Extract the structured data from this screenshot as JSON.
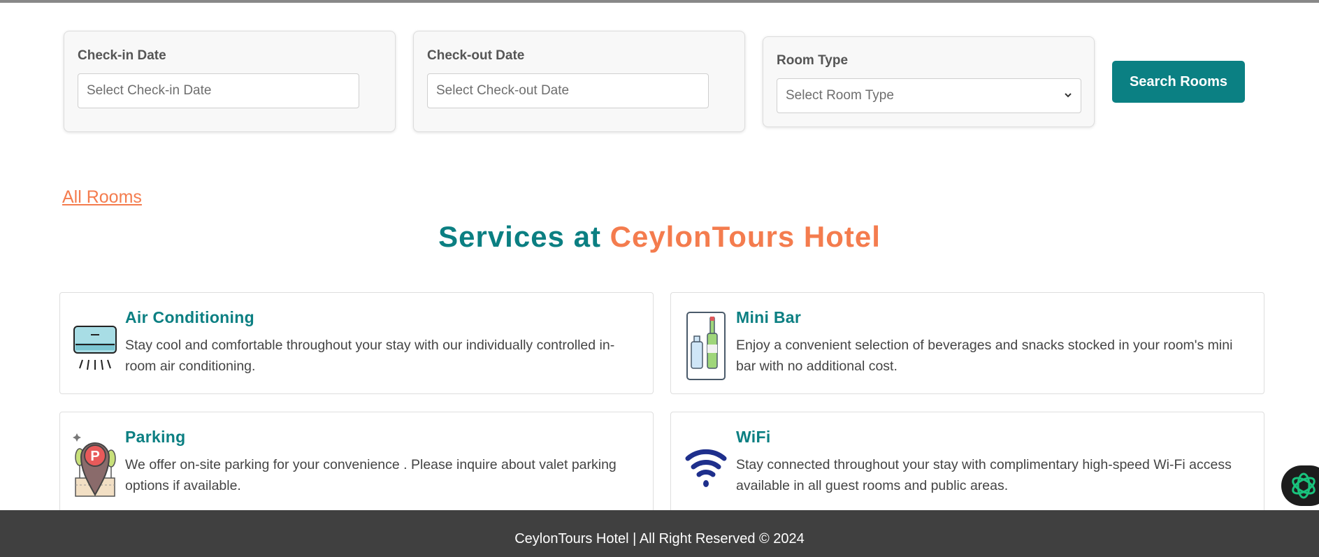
{
  "search": {
    "checkin_label": "Check-in Date",
    "checkin_placeholder": "Select Check-in Date",
    "checkout_label": "Check-out Date",
    "checkout_placeholder": "Select Check-out Date",
    "roomtype_label": "Room Type",
    "roomtype_selected": "Select Room Type",
    "button_label": "Search Rooms"
  },
  "links": {
    "all_rooms": "All Rooms"
  },
  "services": {
    "heading_part1": "Services at ",
    "heading_part2": "CeylonTours Hotel",
    "items": [
      {
        "title": "Air Conditioning",
        "description": "Stay cool and comfortable throughout your stay with our individually controlled in-room air conditioning.",
        "icon": "air-conditioner-icon"
      },
      {
        "title": "Mini Bar",
        "description": "Enjoy a convenient selection of beverages and snacks stocked in your room's mini bar with no additional cost.",
        "icon": "mini-bar-icon"
      },
      {
        "title": "Parking",
        "description": "We offer on-site parking for your convenience . Please inquire about valet parking options if available.",
        "icon": "parking-icon"
      },
      {
        "title": "WiFi",
        "description": "Stay connected throughout your stay with complimentary high-speed Wi-Fi access available in all guest rooms and public areas.",
        "icon": "wifi-icon"
      }
    ]
  },
  "footer": {
    "text": "CeylonTours Hotel | All Right Reserved © 2024"
  },
  "colors": {
    "accent_teal": "#0b7f82",
    "accent_orange": "#f47c4e",
    "footer_bg": "#404040"
  }
}
